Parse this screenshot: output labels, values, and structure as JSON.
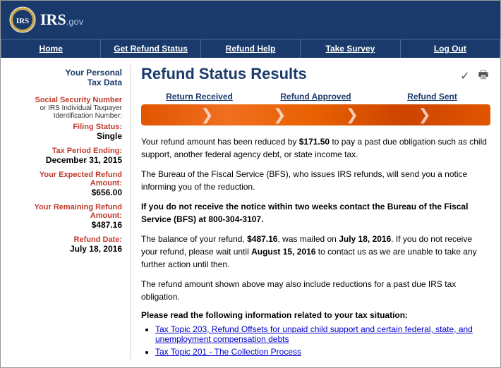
{
  "header": {
    "logo_text": "IRS",
    "logo_gov": ".gov",
    "alt": "IRS.gov logo"
  },
  "nav": {
    "items": [
      {
        "label": "Home",
        "id": "home"
      },
      {
        "label": "Get Refund Status",
        "id": "get-refund-status"
      },
      {
        "label": "Refund Help",
        "id": "refund-help"
      },
      {
        "label": "Take Survey",
        "id": "take-survey"
      },
      {
        "label": "Log Out",
        "id": "log-out"
      }
    ]
  },
  "sidebar": {
    "header_line1": "Your Personal",
    "header_line2": "Tax Data",
    "rows": [
      {
        "label": "Social Security Number",
        "sublabel": "or IRS Individual Taxpayer Identification Number:",
        "value": ""
      },
      {
        "label": "Filing Status:",
        "sublabel": "",
        "value": "Single"
      },
      {
        "label": "Tax Period Ending:",
        "sublabel": "",
        "value": "December 31, 2015"
      },
      {
        "label": "Your Expected Refund Amount:",
        "sublabel": "",
        "value": "$656.00"
      },
      {
        "label": "Your Remaining Refund Amount:",
        "sublabel": "",
        "value": "$487.16"
      },
      {
        "label": "Refund Date:",
        "sublabel": "",
        "value": "July 18, 2016"
      }
    ]
  },
  "content": {
    "page_title": "Refund Status Results",
    "progress": {
      "labels": [
        "Return Received",
        "Refund Approved",
        "Refund Sent"
      ]
    },
    "messages": [
      "Your refund amount has been reduced by <strong>$171.50</strong> to pay a past due obligation such as child support, another federal agency debt, or state income tax.",
      "The Bureau of the Fiscal Service (BFS), who issues IRS refunds, will send you a notice informing you of the reduction.",
      "If you do not receive the notice within two weeks contact the Bureau of the Fiscal Service (BFS) at 800-304-3107.",
      "The balance of your refund, <strong>$487.16</strong>, was mailed on <strong>July 18, 2016</strong>. If you do not receive your refund, please wait until <strong>August 15, 2016</strong> to contact us as we are unable to take any further action until then.",
      "The refund amount shown above may also include reductions for a past due IRS tax obligation."
    ],
    "please_read": {
      "title": "Please read the following information related to your tax situation:",
      "links": [
        {
          "text": "Tax Topic 203, Refund Offsets for unpaid child support and certain federal, state, and unemployment compensation debts",
          "href": "#"
        },
        {
          "text": "Tax Topic 201 - The Collection Process",
          "href": "#"
        }
      ]
    }
  }
}
